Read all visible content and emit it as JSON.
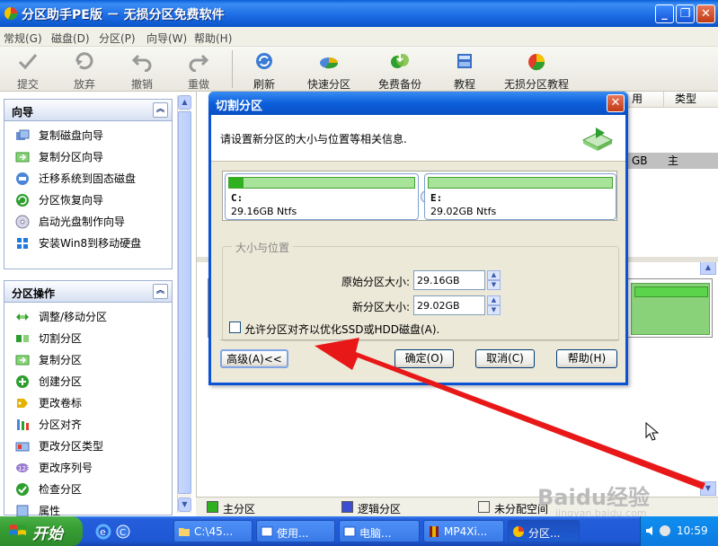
{
  "window": {
    "title": "分区助手PE版 － 无损分区免费软件"
  },
  "menubar": [
    "常规(G)",
    "磁盘(D)",
    "分区(P)",
    "向导(W)",
    "帮助(H)"
  ],
  "toolbar": {
    "commit": "提交",
    "discard": "放弃",
    "undo": "撤销",
    "redo": "重做",
    "refresh": "刷新",
    "quick_partition": "快速分区",
    "free_backup": "免费备份",
    "tutorial": "教程",
    "lossless_tutorial": "无损分区教程"
  },
  "wizard": {
    "title": "向导",
    "items": [
      "复制磁盘向导",
      "复制分区向导",
      "迁移系统到固态磁盘",
      "分区恢复向导",
      "启动光盘制作向导",
      "安装Win8到移动硬盘"
    ]
  },
  "partition_ops": {
    "title": "分区操作",
    "items": [
      "调整/移动分区",
      "切割分区",
      "复制分区",
      "创建分区",
      "更改卷标",
      "分区对齐",
      "更改分区类型",
      "更改序列号",
      "检查分区",
      "属性"
    ]
  },
  "table": {
    "col_used": "用",
    "col_type": "类型",
    "row_size": "GB",
    "row_type": "主"
  },
  "legend": {
    "primary": "主分区",
    "logical": "逻辑分区",
    "unallocated": "未分配空间"
  },
  "dialog": {
    "title": "切割分区",
    "description": "请设置新分区的大小与位置等相关信息.",
    "partition_c": {
      "name": "C:",
      "info": "29.16GB Ntfs",
      "used_fraction": 0.08
    },
    "partition_e": {
      "name": "E:",
      "info": "29.02GB Ntfs",
      "used_fraction": 0.0
    },
    "group_label": "大小与位置",
    "original_size_label": "原始分区大小:",
    "original_size_value": "29.16GB",
    "new_size_label": "新分区大小:",
    "new_size_value": "29.02GB",
    "align_checkbox": "允许分区对齐以优化SSD或HDD磁盘(A).",
    "align_checked": false,
    "btn_advanced": "高级(A)<<",
    "btn_ok": "确定(O)",
    "btn_cancel": "取消(C)",
    "btn_help": "帮助(H)"
  },
  "taskbar": {
    "start": "开始",
    "tasks": [
      "C:\\45...",
      "使用...",
      "电脑...",
      "MP4Xi...",
      "分区..."
    ],
    "clock": "10:59"
  },
  "watermark": {
    "brand": "Baidu经验",
    "url": "jingyan.baidu.com"
  },
  "colors": {
    "accent": "#0a52d6",
    "arrow": "#e81818",
    "partition_fill": "#2fb11f"
  }
}
